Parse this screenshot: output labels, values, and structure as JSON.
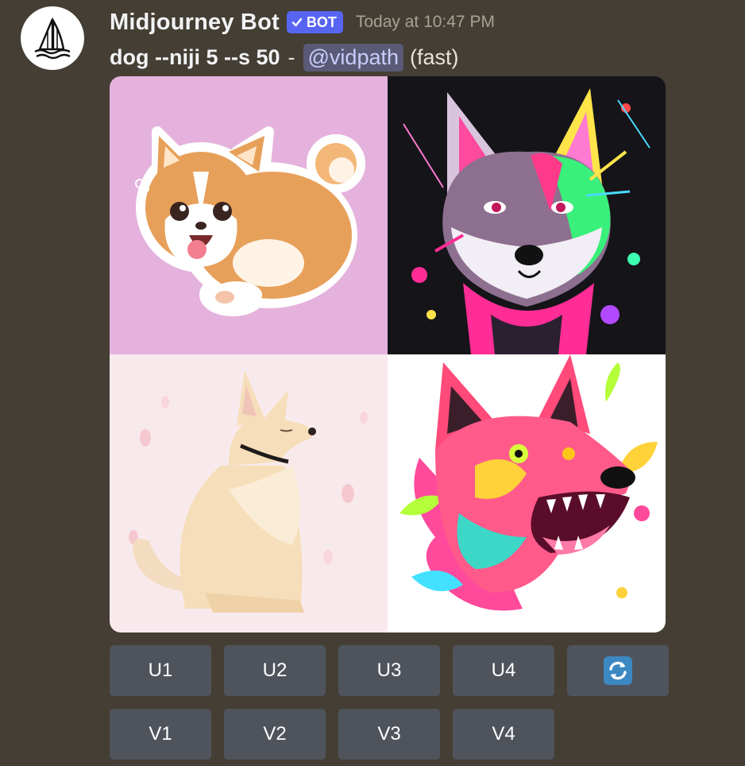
{
  "message": {
    "author": "Midjourney Bot",
    "bot_tag": "BOT",
    "timestamp": "Today at 10:47 PM",
    "prompt": "dog --niji 5 --s 50",
    "separator": "-",
    "mention": "@vidpath",
    "speed": "(fast)",
    "avatar_icon": "sailboat-logo-icon"
  },
  "image_grid": {
    "tiles": [
      {
        "name": "corgi-sticker",
        "background": "#e4b2dc"
      },
      {
        "name": "neon-shiba",
        "background": "#151419"
      },
      {
        "name": "sitting-dog",
        "background": "#f8eaec"
      },
      {
        "name": "neon-wolf",
        "background": "#ffffff"
      }
    ]
  },
  "buttons": {
    "upscale": [
      "U1",
      "U2",
      "U3",
      "U4"
    ],
    "variation": [
      "V1",
      "V2",
      "V3",
      "V4"
    ],
    "reroll_icon": "reroll-icon"
  },
  "colors": {
    "background": "#443e34",
    "button": "#4f545c",
    "bot_tag": "#5865f2",
    "mention_bg": "#5a5a76",
    "reroll": "#3b88c3"
  }
}
